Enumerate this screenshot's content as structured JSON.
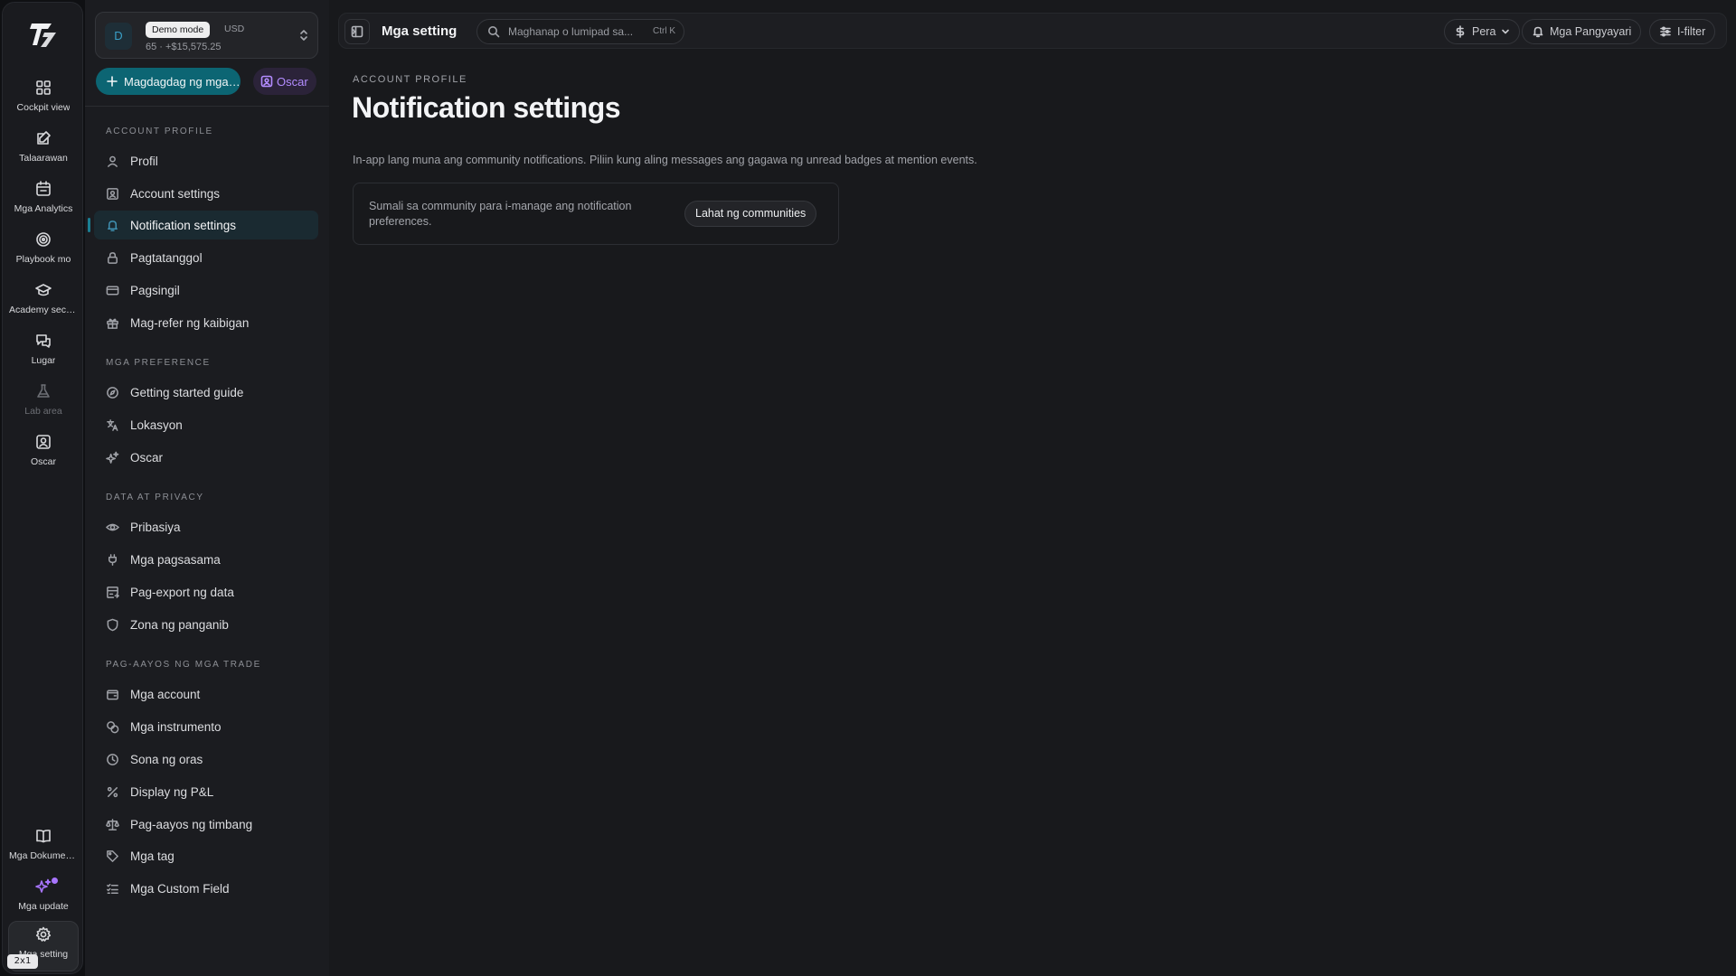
{
  "rail": {
    "items": [
      {
        "label": "Cockpit view",
        "icon": "dashboard-grid-icon"
      },
      {
        "label": "Talaarawan",
        "icon": "journal-edit-icon"
      },
      {
        "label": "Mga Analytics",
        "icon": "calendar-icon"
      },
      {
        "label": "Playbook mo",
        "icon": "target-icon"
      },
      {
        "label": "Academy section",
        "icon": "graduation-cap-icon"
      },
      {
        "label": "Lugar",
        "icon": "chat-bubbles-icon"
      },
      {
        "label": "Lab area",
        "icon": "flask-icon"
      },
      {
        "label": "Oscar",
        "icon": "assistant-portrait-icon"
      }
    ],
    "bottom_items": [
      {
        "label": "Mga Dokumentasyon",
        "icon": "book-icon"
      },
      {
        "label": "Mga update",
        "icon": "sparkles-icon"
      },
      {
        "label": "Mga setting",
        "icon": "gear-icon"
      }
    ],
    "zoom_badge": "2x1"
  },
  "account": {
    "avatar_initial": "D",
    "mode_pill": "Demo mode",
    "currency": "USD",
    "subtitle": "65 · +$15,575.25"
  },
  "actions": {
    "add_label": "Magdagdag ng mga trade",
    "oscar_label": "Oscar"
  },
  "sidebar": {
    "sections": [
      {
        "title": "ACCOUNT PROFILE",
        "items": [
          {
            "label": "Profil",
            "icon": "user-icon"
          },
          {
            "label": "Account settings",
            "icon": "id-card-icon"
          },
          {
            "label": "Notification settings",
            "icon": "bell-icon",
            "active": true
          },
          {
            "label": "Pagtatanggol",
            "icon": "lock-icon"
          },
          {
            "label": "Pagsingil",
            "icon": "credit-card-icon"
          },
          {
            "label": "Mag-refer ng kaibigan",
            "icon": "gift-icon"
          }
        ]
      },
      {
        "title": "MGA PREFERENCE",
        "items": [
          {
            "label": "Getting started guide",
            "icon": "compass-icon"
          },
          {
            "label": "Lokasyon",
            "icon": "translate-icon"
          },
          {
            "label": "Oscar",
            "icon": "sparkles-icon"
          }
        ]
      },
      {
        "title": "DATA AT PRIVACY",
        "items": [
          {
            "label": "Pribasiya",
            "icon": "eye-icon"
          },
          {
            "label": "Mga pagsasama",
            "icon": "plug-icon"
          },
          {
            "label": "Pag-export ng data",
            "icon": "database-export-icon"
          },
          {
            "label": "Zona ng panganib",
            "icon": "shield-icon"
          }
        ]
      },
      {
        "title": "PAG-AAYOS NG MGA TRADE",
        "items": [
          {
            "label": "Mga account",
            "icon": "wallet-icon"
          },
          {
            "label": "Mga instrumento",
            "icon": "coins-icon"
          },
          {
            "label": "Sona ng oras",
            "icon": "clock-icon"
          },
          {
            "label": "Display ng P&L",
            "icon": "percent-icon"
          },
          {
            "label": "Pag-aayos ng timbang",
            "icon": "scale-icon"
          },
          {
            "label": "Mga tag",
            "icon": "tag-icon"
          },
          {
            "label": "Mga Custom Field",
            "icon": "checklist-icon"
          }
        ]
      }
    ]
  },
  "topbar": {
    "title": "Mga setting",
    "search_placeholder": "Maghanap o lumipad sa...",
    "search_shortcut": "Ctrl K",
    "currency_button": "Pera",
    "events_button": "Mga Pangyayari",
    "filter_button": "I-filter"
  },
  "page": {
    "eyebrow": "ACCOUNT PROFILE",
    "title": "Notification settings",
    "description": "In-app lang muna ang community notifications. Piliin kung aling messages ang gagawa ng unread badges at mention events.",
    "card_text": "Sumali sa community para i-manage ang notification preferences.",
    "card_button": "Lahat ng communities"
  },
  "colors": {
    "accent": "#0c6573",
    "oscar": "#b38cff",
    "background": "#18191c"
  }
}
